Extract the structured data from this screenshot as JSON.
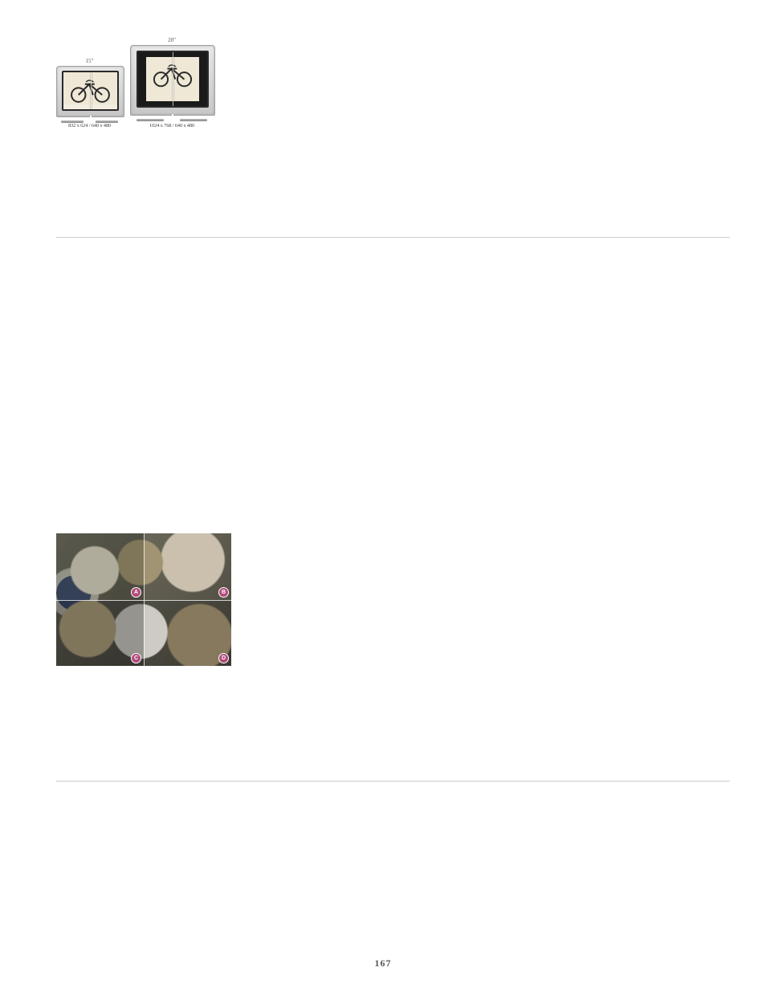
{
  "page_number": "167",
  "figure1": {
    "monitors": [
      {
        "size_label": "15\"",
        "resolution_label": "832 x 624 / 640 x 480"
      },
      {
        "size_label": "20\"",
        "resolution_label": "1024 x 768 / 640 x 480"
      }
    ]
  },
  "figure2": {
    "quadrants": [
      "A",
      "B",
      "C",
      "D"
    ]
  }
}
